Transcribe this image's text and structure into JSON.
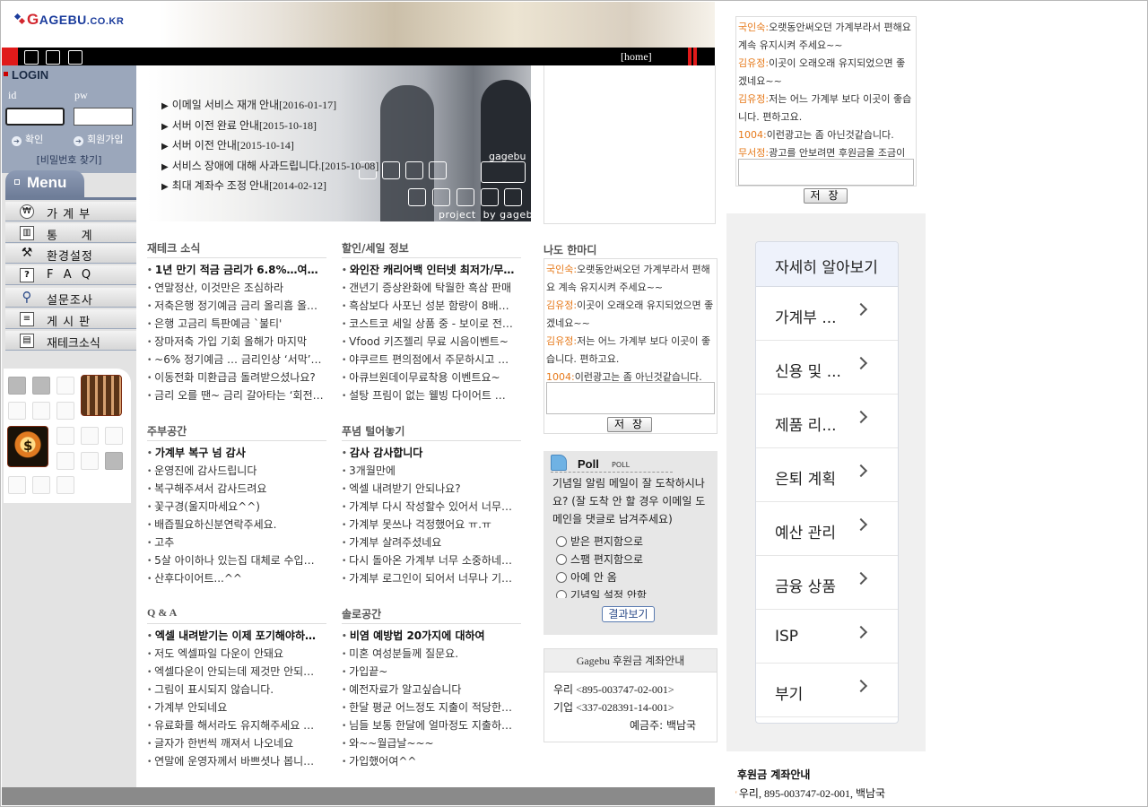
{
  "header": {
    "logo_g": "G",
    "logo_text": "AGEBU",
    "logo_suffix": ".CO.KR",
    "home_link": "[home]"
  },
  "login": {
    "title": "LOGIN",
    "id_label": "id",
    "pw_label": "pw",
    "confirm": "확인",
    "join": "회원가입",
    "find_pw": "[비밀번호 찾기]"
  },
  "menu": {
    "title": "Menu",
    "items": [
      {
        "label": "가 계 부",
        "icon": "won-coin-icon"
      },
      {
        "label": "통     계",
        "icon": "chart-icon"
      },
      {
        "label": "환경설정",
        "icon": "tools-icon"
      },
      {
        "label": "F  A  Q",
        "icon": "question-icon"
      },
      {
        "label": "설문조사",
        "icon": "magnifier-icon"
      },
      {
        "label": "게 시 판",
        "icon": "document-icon"
      },
      {
        "label": "재테크소식",
        "icon": "clipboard-icon"
      }
    ]
  },
  "banner": {
    "notices": [
      "최대 계좌수 조정 안내[2014-02-12]",
      "서비스 장애에 대해 사과드립니다.[2015-10-08]",
      "서버 이전 안내[2015-10-14]",
      "서버 이전 완료 안내[2015-10-18]",
      "이메일 서비스 재개 안내[2016-01-17]"
    ],
    "tag": "gagebu",
    "credit": "project  by gagebu"
  },
  "sections": {
    "finance": {
      "title": "재테크 소식",
      "items": [
        "1년 만기 적금 금리가 6.8%…여웃…",
        "연말정산, 이것만은 조심하라",
        "저축은행 정기예금 금리 올리흠 올…",
        "은행 고금리 특판예금 `불티'",
        "장마저축 가입 기회 올해가 마지막",
        "~6% 정기예금 … 금리인상 ‘서막’…",
        "이동전화 미환급금 돌려받으셨나요?",
        "금리 오를 땐~ 금리 갈아타는 ‘회전…"
      ]
    },
    "sale": {
      "title": "할인/세일 정보",
      "items": [
        "와인잔 캐리어백 인터넷 최저가/무…",
        "갠년기 증상완화에 탁월한 흑삼 판매",
        "흑삼보다 사포닌 성분 함량이 8배…",
        "코스트코 세일 상품 중 - 보이로 전…",
        "Vfood 키즈젤리 무료 시음이벤트~",
        "야쿠르트 편의점에서 주문하시고 …",
        "아큐브원데이무료착용 이벤트요~",
        "설탕 프림이 없는 웰빙 다이어트 …"
      ]
    },
    "housewife": {
      "title": "주부공간",
      "items": [
        "가계부 복구 넘 감사",
        "운영진에 감사드립니다",
        "복구해주셔서 감사드려요",
        "꽃구경(울지마세요^^)",
        "배즙필요하신분연락주세요.",
        "고추",
        "5살 아이하나 있는집 대체로 수입…",
        "산후다이어트...^^"
      ]
    },
    "vent": {
      "title": "푸념 털어놓기",
      "items": [
        "감사 감사합니다",
        "3개월만에",
        "엑셀 내려받기 안되나요?",
        "가계부 다시 작성할수 있어서 너무…",
        "가계부 못쓰나 걱정했어요 ㅠ.ㅠ",
        "가계부 살려주셨네요",
        "다시 돌아온 가계부 너무 소중하네…",
        "가계부 로그인이 되어서 너무나 기…"
      ]
    },
    "qa": {
      "title": "Q & A",
      "items": [
        "엑셀 내려받기는 이제 포기해야하…",
        "저도 엑셀파일 다운이 안돼요",
        "엑셀다운이 안되는데 제것만 안되…",
        "그림이 표시되지 않습니다.",
        "가계부 안되네요",
        "유료화를 해서라도 유지해주세요 …",
        "글자가 한번씩 깨져서 나오네요",
        "연말에 운영자께서 바쁘셧나 봅니…"
      ]
    },
    "single": {
      "title": "솔로공간",
      "items": [
        "비염 예방법 20가지에 대하여",
        "미혼 여성분들께 질문요.",
        "가입끝~",
        "예전자료가 알고싶습니다",
        "한달 평균 어느정도 지출이 적당한…",
        "님들 보통 한달에 얼마정도 지출하…",
        "와~~월급날~~~",
        "가입했어여^^"
      ]
    }
  },
  "hanmadi": {
    "title": "나도 한마디",
    "entries": [
      {
        "name": "국인숙:",
        "text": "오랫동안써오던 가계부라서 편해요 계속 유지시켜 주세요~~"
      },
      {
        "name": "김유정:",
        "text": "이곳이 오래오래 유지되었으면 좋겠네요~~"
      },
      {
        "name": "김유정:",
        "text": "저는 어느 가계부 보다 이곳이 좋습니다. 편하고요."
      },
      {
        "name": "1004:",
        "text": "이런광고는 좀 아닌것같습니다."
      },
      {
        "name": "무서정:",
        "text": "광고를 안보려면 후원금을 조금이라"
      }
    ],
    "save": "저 장"
  },
  "poll": {
    "title": "Poll",
    "subtitle": "POLL",
    "question": "기념일 알림 메일이 잘 도착하시나요? (잘 도착 안 할 경우 이메일 도메인을 댓글로 남겨주세요)",
    "options": [
      "받은 편지함으로",
      "스팸 편지함으로",
      "아예 안 옴",
      "기념일 설정 안함"
    ],
    "result": "결과보기"
  },
  "donation": {
    "title": "Gagebu 후원금 계좌안내",
    "line1": "우리 <895-003747-02-001>",
    "line2": "기업 <337-028391-14-001>",
    "owner": "예금주: 백남국"
  },
  "right_panel": {
    "save": "저 장",
    "learn_more": {
      "title": "자세히 알아보기",
      "items": [
        "가계부 ...",
        "신용 및 ...",
        "제품 리...",
        "은퇴 계획",
        "예산 관리",
        "금융 상품",
        "ISP",
        "부기"
      ]
    },
    "footer_title": "후원금 계좌안내",
    "footer_line": "우리, 895-003747-02-001, 백남국"
  },
  "colors": {
    "sidebar_blue": "#9ba7bb",
    "name_orange": "#e67818",
    "logo_blue": "#1b3c9c",
    "accent_red": "#e01a1a"
  }
}
